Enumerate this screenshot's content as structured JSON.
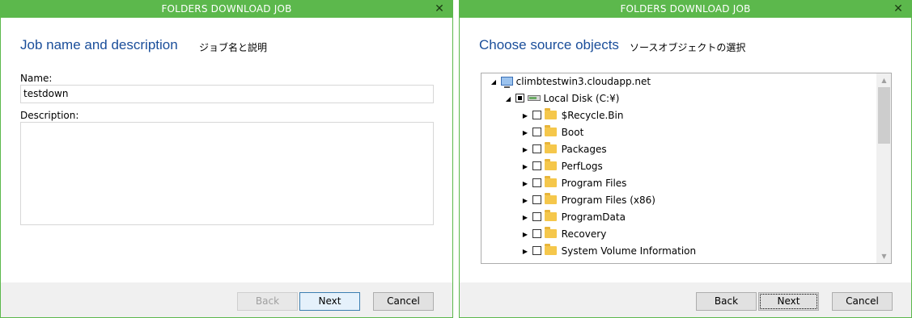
{
  "dialog1": {
    "title": "FOLDERS DOWNLOAD JOB",
    "heading": "Job name and description",
    "heading_jp": "ジョブ名と説明",
    "name_label": "Name:",
    "name_value": "testdown",
    "description_label": "Description:",
    "description_value": "",
    "buttons": {
      "back": "Back",
      "next": "Next",
      "cancel": "Cancel"
    }
  },
  "dialog2": {
    "title": "FOLDERS DOWNLOAD JOB",
    "heading": "Choose source objects",
    "heading_jp": "ソースオブジェクトの選択",
    "tree": {
      "root": "climbtestwin3.cloudapp.net",
      "disk": "Local Disk (C:¥)",
      "folders": [
        "$Recycle.Bin",
        "Boot",
        "Packages",
        "PerfLogs",
        "Program Files",
        "Program Files (x86)",
        "ProgramData",
        "Recovery",
        "System Volume Information"
      ]
    },
    "buttons": {
      "back": "Back",
      "next": "Next",
      "cancel": "Cancel"
    }
  },
  "colors": {
    "title_bar": "#5cb84c",
    "heading": "#1a4e9a",
    "footer": "#f0f0f0",
    "folder": "#f5c74b"
  },
  "icons": {
    "close": "close-icon",
    "expand": "triangle-right-icon",
    "collapse": "triangle-down-icon",
    "folder": "folder-icon",
    "computer": "computer-icon",
    "disk": "disk-icon"
  }
}
